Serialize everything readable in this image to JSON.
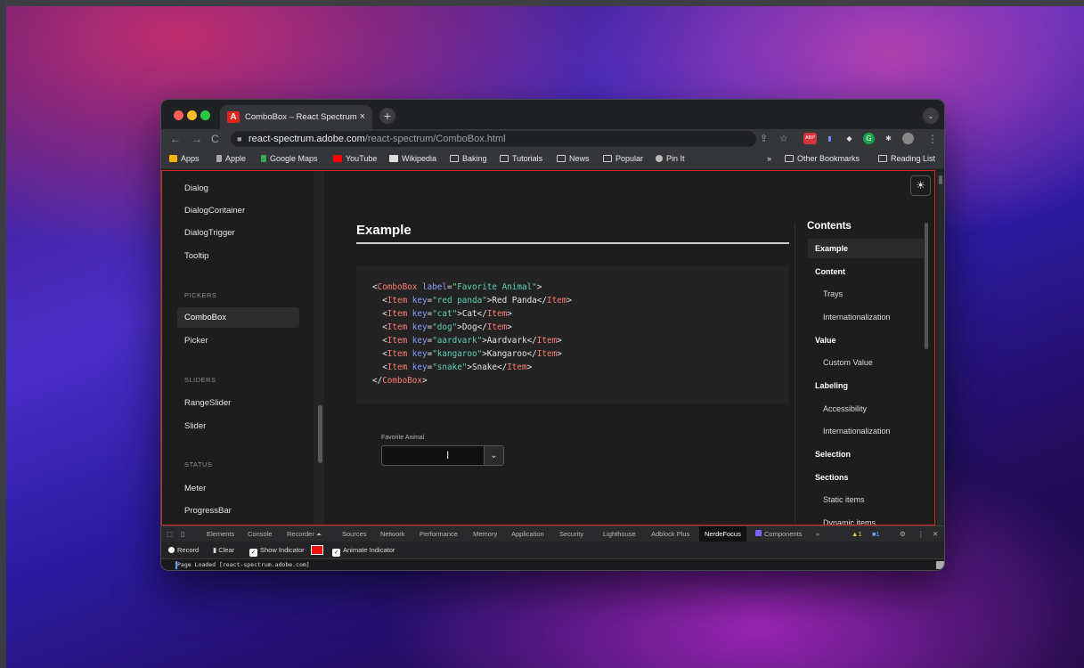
{
  "browser": {
    "tab_title": "ComboBox – React Spectrum",
    "tab_favicon": "A",
    "close_glyph": "×",
    "newtab_glyph": "+",
    "menu_glyph": "⌄",
    "url_host": "react-spectrum.adobe.com",
    "url_path": "/react-spectrum/ComboBox.html",
    "ext_abp": "ABP"
  },
  "bookmarks": {
    "items": [
      "Apps",
      "Apple",
      "Google Maps",
      "YouTube",
      "Wikipedia",
      "Baking",
      "Tutorials",
      "News",
      "Popular",
      "Pin It"
    ],
    "overflow": "»",
    "other": "Other Bookmarks",
    "reading": "Reading List"
  },
  "sidebar": {
    "items": [
      "Dialog",
      "DialogContainer",
      "DialogTrigger",
      "Tooltip"
    ],
    "pickers_head": "PICKERS",
    "pickers": [
      "ComboBox",
      "Picker"
    ],
    "sliders_head": "SLIDERS",
    "sliders": [
      "RangeSlider",
      "Slider"
    ],
    "status_head": "STATUS",
    "status": [
      "Meter",
      "ProgressBar"
    ]
  },
  "main": {
    "heading": "Example",
    "code": {
      "open_tag": "ComboBox",
      "label_attr": "label",
      "label_value": "\"Favorite Animal\"",
      "item_tag": "Item",
      "key_attr": "key",
      "items": [
        {
          "key": "\"red panda\"",
          "text": "Red Panda"
        },
        {
          "key": "\"cat\"",
          "text": "Cat"
        },
        {
          "key": "\"dog\"",
          "text": "Dog"
        },
        {
          "key": "\"aardvark\"",
          "text": "Aardvark"
        },
        {
          "key": "\"kangaroo\"",
          "text": "Kangaroo"
        },
        {
          "key": "\"snake\"",
          "text": "Snake"
        }
      ]
    },
    "field_label": "Favorite Animal",
    "combo_value": ""
  },
  "toc": {
    "title": "Contents",
    "items": [
      "Example",
      "Content",
      "Trays",
      "Internationalization",
      "Value",
      "Custom Value",
      "Labeling",
      "Accessibility",
      "Internationalization",
      "Selection",
      "Sections",
      "Static items",
      "Dynamic items"
    ]
  },
  "devtools": {
    "tabs": [
      "Elements",
      "Console",
      "Recorder ⏶",
      "Sources",
      "Network",
      "Performance",
      "Memory",
      "Application",
      "Security",
      "Lighthouse",
      "Adblock Plus",
      "NerdeFocus",
      "Components"
    ],
    "more": "»",
    "warn_count": "1",
    "info_count": "1",
    "record": "Record",
    "clear": "Clear",
    "show_indicator": "Show Indicator",
    "animate_indicator": "Animate Indicator",
    "console_line": "Page Loaded [react-spectrum.adobe.com]"
  },
  "colors": {
    "accent_red": "#e1251b",
    "code_tag": "#ff7a72",
    "code_attr": "#8a9bff",
    "code_string": "#5ed1b8"
  }
}
